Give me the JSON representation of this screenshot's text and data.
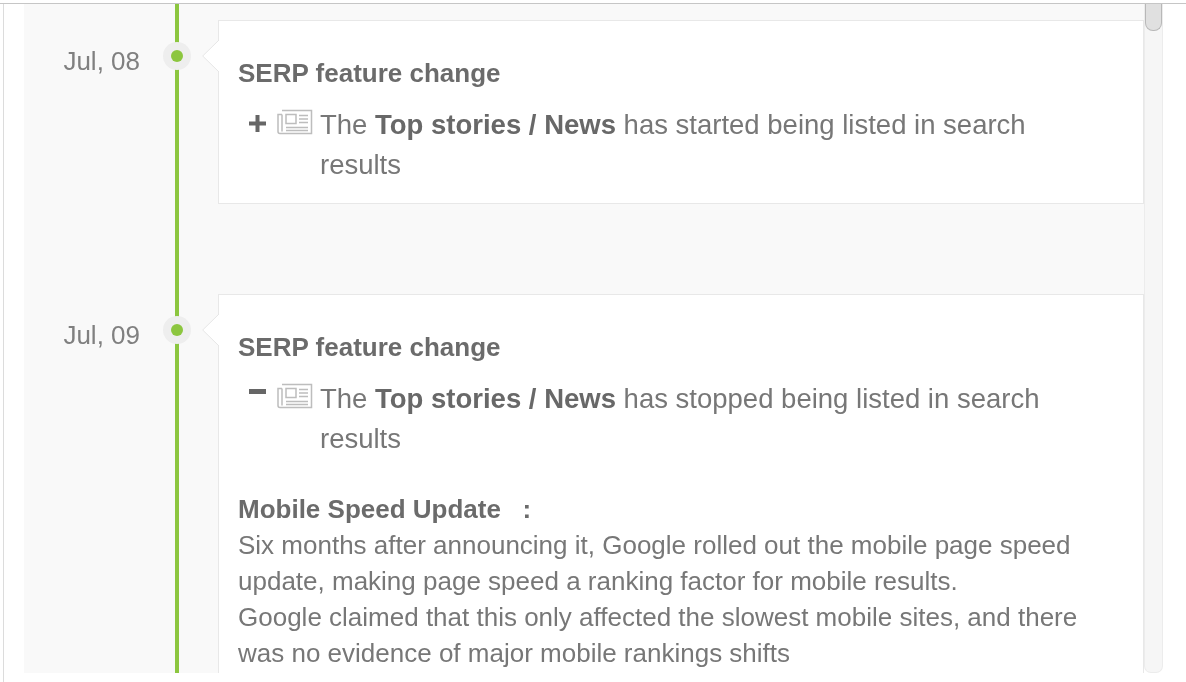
{
  "timeline": {
    "events": [
      {
        "date": "Jul, 08",
        "title": "SERP feature change",
        "change": {
          "kind": "added",
          "text": "The **Top stories / News** has started being listed in search results"
        }
      },
      {
        "date": "Jul, 09",
        "title": "SERP feature change",
        "change": {
          "kind": "removed",
          "text": "The **Top stories / News** has stopped being listed in search results"
        },
        "note": {
          "title": "Mobile Speed Update   :",
          "paragraphs": [
            "Six months after announcing it, Google rolled out the mobile page speed update, making page speed a ranking factor for mobile results.",
            "Google claimed that this only affected the slowest mobile sites, and there was no evidence of major mobile rankings shifts"
          ]
        }
      }
    ]
  }
}
